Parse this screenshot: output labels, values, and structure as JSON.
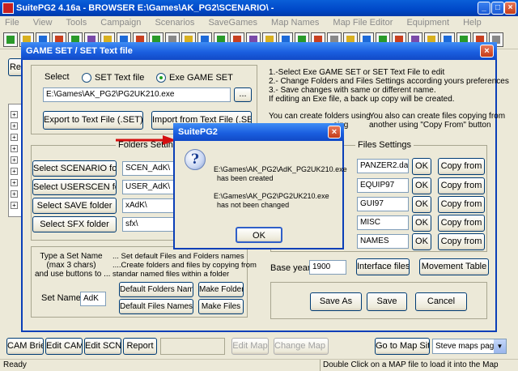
{
  "window": {
    "title": "SuitePG2 4.16a  -  BROWSER   E:\\Games\\AK_PG2\\SCENARIO\\ -"
  },
  "menu": [
    "File",
    "View",
    "Tools",
    "Campaign",
    "Scenarios",
    "SaveGames",
    "Map Names",
    "Map File Editor",
    "Equipment",
    "Help"
  ],
  "behind_label": "Re",
  "dialog": {
    "title": "GAME SET  /  SET Text file",
    "select_label": "Select",
    "radio_text": "SET Text file",
    "radio_exe": "Exe GAME SET",
    "radio_selected": "exe",
    "path_value": "E:\\Games\\AK_PG2\\PG2UK210.exe",
    "browse_label": "...",
    "export_button": "Export to Text File (.SET)",
    "import_button": "Import from Text File (.SET)",
    "instructions": [
      "1.-Select Exe GAME SET or SET Text File to edit",
      "2.- Change Folders and Files Settings according yours  preferences",
      "3.- Save changes with same or different name.",
      "     If editing an Exe file, a back up copy will be created."
    ],
    "note_left": [
      "You can create folders using",
      "sing"
    ],
    "note_right": [
      "You also can create files copying from",
      "another using \"Copy From\" button"
    ],
    "folders_caption": "Folders Settings",
    "files_caption": "Files Settings",
    "folders": [
      {
        "button": "Select SCENARIO folder",
        "value": "SCEN_AdK\\"
      },
      {
        "button": "Select USERSCEN folder",
        "value": "USER_AdK\\"
      },
      {
        "button": "Select SAVE folder",
        "value": "xAdK\\"
      },
      {
        "button": "Select SFX folder",
        "value": "sfx\\"
      }
    ],
    "files": [
      {
        "value": "PANZER2.dat",
        "ok": "OK",
        "copy": "Copy from"
      },
      {
        "value": "EQUIP97",
        "ok": "OK",
        "copy": "Copy from"
      },
      {
        "value": "GUI97",
        "ok": "OK",
        "copy": "Copy from"
      },
      {
        "value": "MISC",
        "ok": "OK",
        "copy": "Copy from"
      },
      {
        "value": "NAMES",
        "ok": "OK",
        "copy": "Copy from"
      }
    ],
    "set_help_left": [
      "Type a Set Name",
      "(max 3 chars)",
      "and use buttons to ..."
    ],
    "set_help_right": [
      "... Set default Files and Folders names",
      "....Create folders and files by copying from",
      "     standar named files within a folder"
    ],
    "default_folders_button": "Default Folders Names",
    "make_folders_button": "Make Folders",
    "default_files_button": "Default Files Names",
    "make_files_button": "Make Files",
    "set_name_label": "Set Name:",
    "set_name_value": "AdK",
    "base_year_label": "Base year",
    "base_year_value": "1900",
    "interface_button": "Interface files",
    "movement_button": "Movement Table",
    "save_as_button": "Save As",
    "save_button": "Save",
    "cancel_button": "Cancel"
  },
  "msgbox": {
    "title": "SuitePG2",
    "line1": "E:\\Games\\AK_PG2\\AdK_PG2UK210.exe",
    "line2": "has been created",
    "line3": "E:\\Games\\AK_PG2\\PG2UK210.exe",
    "line4": "has not been changed",
    "ok": "OK"
  },
  "bottom": {
    "cam_brief": "CAM Brief",
    "edit_cam": "Edit CAM",
    "edit_scn": "Edit SCN",
    "report": "Report",
    "edit_map": "Edit Map",
    "change_map": "Change Map #",
    "go_to_map_site": "Go to Map Site",
    "maps_select": "Steve maps page"
  },
  "status": {
    "left": "Ready",
    "right": "Double Click on a MAP file to load it into the Map Editor"
  },
  "colors": {
    "title_blue": "#0a5fd8",
    "dialog_bg": "#ece9d8",
    "arrow_red": "#d41010"
  }
}
